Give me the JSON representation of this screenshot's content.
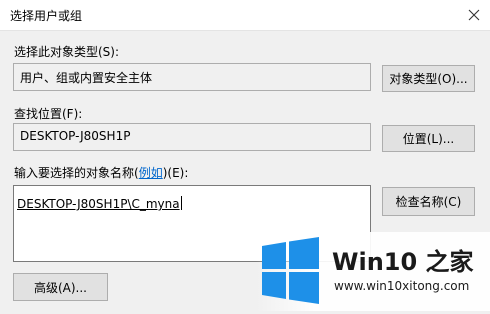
{
  "window": {
    "title": "选择用户或组"
  },
  "object_type": {
    "label": "选择此对象类型(S):",
    "value": "用户、组或内置安全主体",
    "button": "对象类型(O)..."
  },
  "location": {
    "label": "查找位置(F):",
    "value": "DESKTOP-J80SH1P",
    "button": "位置(L)..."
  },
  "names": {
    "label_prefix": "输入要选择的对象名称(",
    "label_link": "例如",
    "label_suffix": ")(E):",
    "value": "DESKTOP-J80SH1P\\C_myna",
    "check_button": "检查名称(C)"
  },
  "advanced_button": "高级(A)...",
  "watermark": {
    "brand": "Win10 之家",
    "url": "www.win10xitong.com",
    "colors": {
      "logo": "#1e90e8",
      "text": "#1a1a1a"
    }
  }
}
